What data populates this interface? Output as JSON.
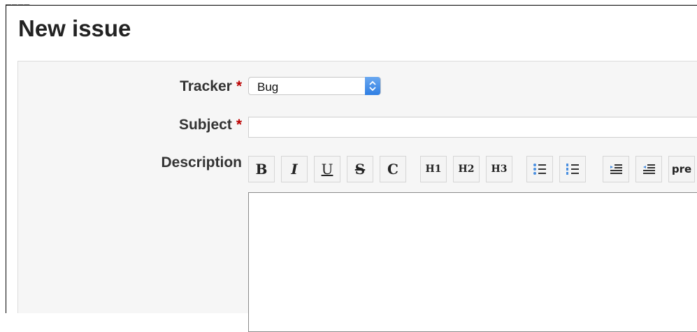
{
  "header": {
    "fragment": "____",
    "title": "New issue"
  },
  "form": {
    "tracker": {
      "label": "Tracker",
      "required_mark": "*",
      "value": "Bug"
    },
    "subject": {
      "label": "Subject",
      "required_mark": "*",
      "value": ""
    },
    "description": {
      "label": "Description",
      "value": ""
    }
  },
  "toolbar": {
    "buttons": [
      {
        "label": "B",
        "name": "bold"
      },
      {
        "label": "I",
        "name": "italic"
      },
      {
        "label": "U",
        "name": "underline"
      },
      {
        "label": "S",
        "name": "strikethrough"
      },
      {
        "label": "C",
        "name": "inline-code"
      },
      {
        "label": "H1",
        "name": "heading-1"
      },
      {
        "label": "H2",
        "name": "heading-2"
      },
      {
        "label": "H3",
        "name": "heading-3"
      },
      {
        "label": "",
        "name": "unordered-list",
        "icon": "bulleted-list-icon"
      },
      {
        "label": "",
        "name": "ordered-list",
        "icon": "numbered-list-icon"
      },
      {
        "label": "",
        "name": "quote",
        "icon": "indent-icon"
      },
      {
        "label": "",
        "name": "unquote",
        "icon": "outdent-icon"
      },
      {
        "label": "pre",
        "name": "preformatted"
      }
    ]
  },
  "colors": {
    "required": "#bb0000",
    "select_accent": "#2f7fe3"
  }
}
